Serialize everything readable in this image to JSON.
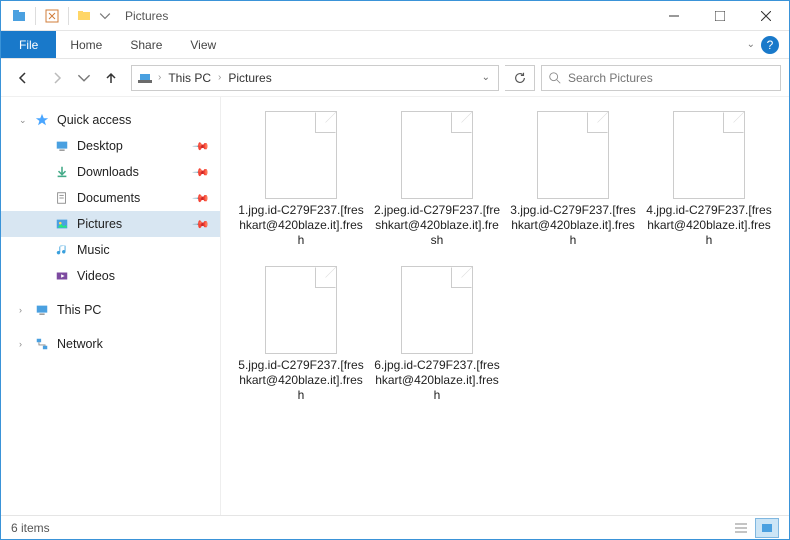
{
  "titlebar": {
    "title": "Pictures"
  },
  "ribbon": {
    "file": "File",
    "tabs": [
      "Home",
      "Share",
      "View"
    ]
  },
  "breadcrumb": {
    "segments": [
      "This PC",
      "Pictures"
    ]
  },
  "search": {
    "placeholder": "Search Pictures"
  },
  "sidebar": {
    "quick_access": "Quick access",
    "items": [
      {
        "label": "Desktop",
        "icon": "desktop-icon",
        "pinned": true
      },
      {
        "label": "Downloads",
        "icon": "downloads-icon",
        "pinned": true
      },
      {
        "label": "Documents",
        "icon": "documents-icon",
        "pinned": true
      },
      {
        "label": "Pictures",
        "icon": "pictures-icon",
        "pinned": true,
        "selected": true
      },
      {
        "label": "Music",
        "icon": "music-icon",
        "pinned": false
      },
      {
        "label": "Videos",
        "icon": "videos-icon",
        "pinned": false
      }
    ],
    "this_pc": "This PC",
    "network": "Network"
  },
  "files": [
    {
      "name": "1.jpg.id-C279F237.[freshkart@420blaze.it].fresh"
    },
    {
      "name": "2.jpeg.id-C279F237.[freshkart@420blaze.it].fresh"
    },
    {
      "name": "3.jpg.id-C279F237.[freshkart@420blaze.it].fresh"
    },
    {
      "name": "4.jpg.id-C279F237.[freshkart@420blaze.it].fresh"
    },
    {
      "name": "5.jpg.id-C279F237.[freshkart@420blaze.it].fresh"
    },
    {
      "name": "6.jpg.id-C279F237.[freshkart@420blaze.it].fresh"
    }
  ],
  "status": {
    "text": "6 items"
  }
}
